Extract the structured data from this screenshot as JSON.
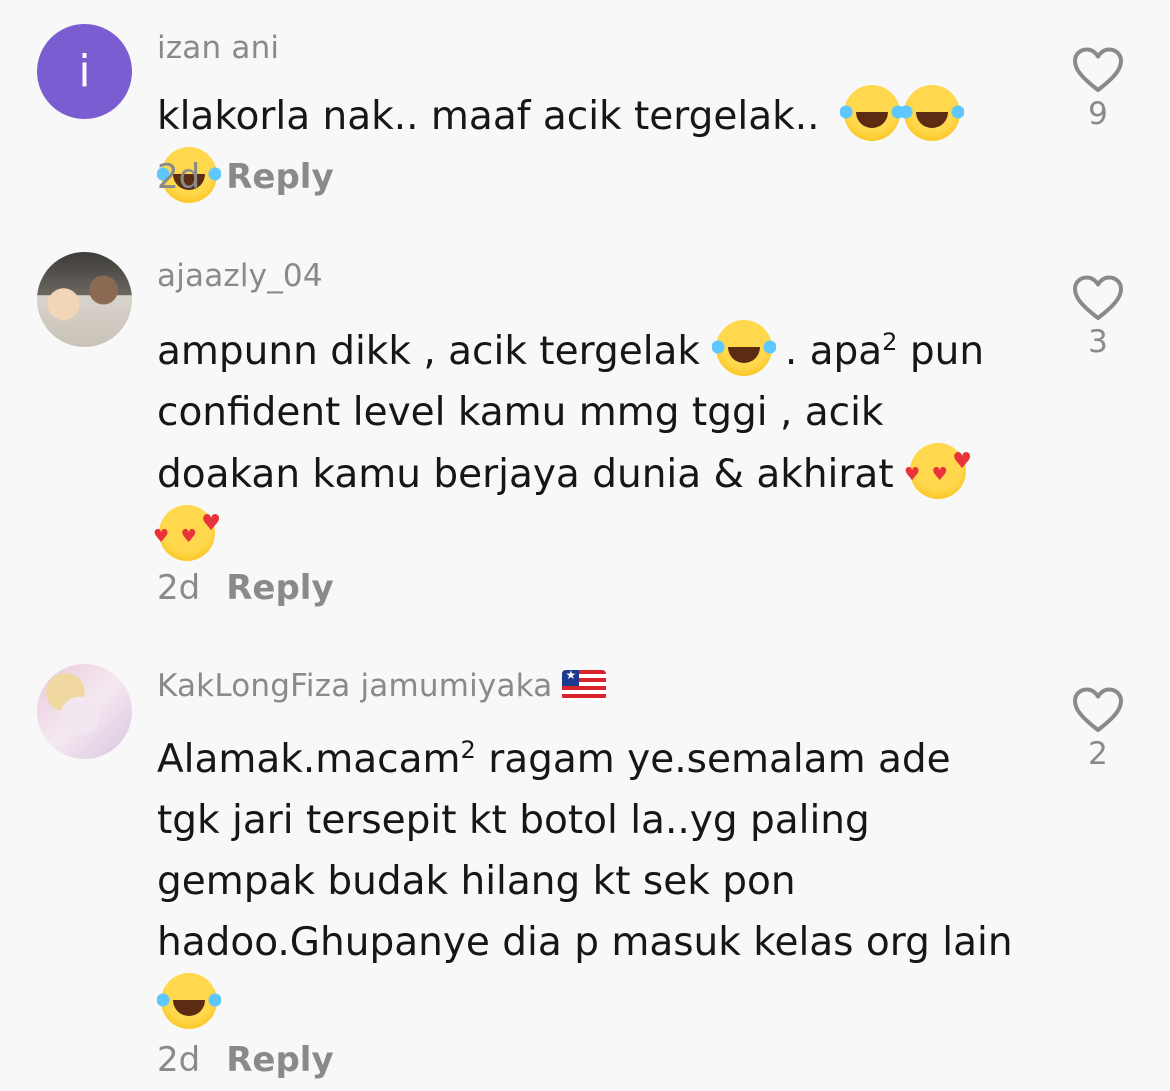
{
  "comments": [
    {
      "username": "izan ani",
      "avatar_letter": "i",
      "text": "klakorla nak.. maaf acik tergelak..",
      "time": "2d",
      "reply_label": "Reply",
      "likes": "9",
      "emojis": [
        "face-with-tears-of-joy",
        "face-with-tears-of-joy",
        "face-with-tears-of-joy"
      ]
    },
    {
      "username": "ajaazly_04",
      "text_part1": "ampunn dikk , acik tergelak",
      "text_part2": " . apa",
      "text_sup": "2",
      "text_part3": " pun confident level kamu mmg tggi , acik doakan kamu berjaya dunia & akhirat",
      "time": "2d",
      "reply_label": "Reply",
      "likes": "3",
      "emojis": [
        "face-with-tears-of-joy",
        "smiling-face-with-hearts",
        "smiling-face-with-hearts"
      ]
    },
    {
      "username": "KakLongFiza jamumiyaka",
      "flag": "liberia-flag",
      "text_part1": "Alamak.macam",
      "text_sup": "2",
      "text_part2": " ragam ye.semalam ade tgk jari tersepit kt botol la..yg paling gempak budak hilang kt sek pon hadoo.Ghupanye dia p masuk kelas org lain",
      "time": "2d",
      "reply_label": "Reply",
      "likes": "2",
      "emojis": [
        "face-with-tears-of-joy"
      ]
    }
  ],
  "colors": {
    "background": "#f8f8f8",
    "text": "#161616",
    "muted": "#8a8a8a",
    "avatar_letter_bg": "#7a5dd1"
  },
  "icons": {
    "like": "heart-outline-icon"
  }
}
